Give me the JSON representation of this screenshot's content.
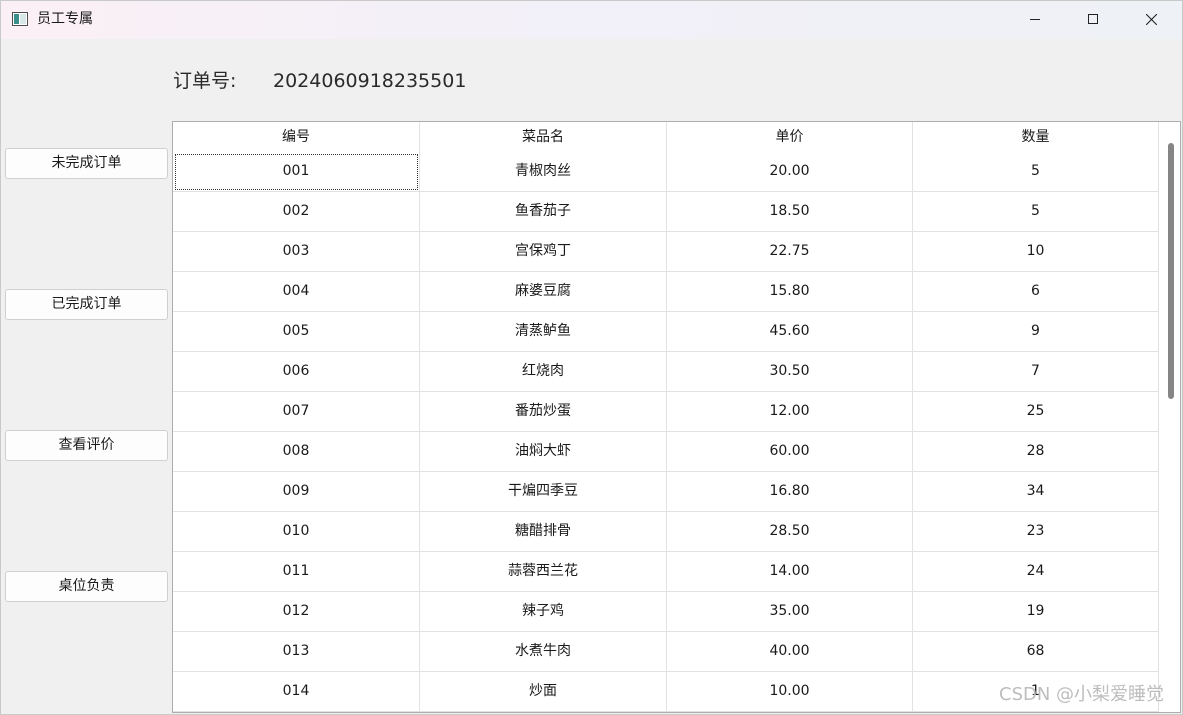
{
  "window": {
    "title": "员工专属",
    "minimize_icon": "minimize-icon",
    "maximize_icon": "maximize-icon",
    "close_icon": "close-icon"
  },
  "order": {
    "label": "订单号:",
    "number": "2024060918235501"
  },
  "sidebar": {
    "buttons": [
      {
        "label": "未完成订单"
      },
      {
        "label": "已完成订单"
      },
      {
        "label": "查看评价"
      },
      {
        "label": "桌位负责"
      }
    ]
  },
  "table": {
    "headers": [
      "编号",
      "菜品名",
      "单价",
      "数量"
    ],
    "rows": [
      [
        "001",
        "青椒肉丝",
        "20.00",
        "5"
      ],
      [
        "002",
        "鱼香茄子",
        "18.50",
        "5"
      ],
      [
        "003",
        "宫保鸡丁",
        "22.75",
        "10"
      ],
      [
        "004",
        "麻婆豆腐",
        "15.80",
        "6"
      ],
      [
        "005",
        "清蒸鲈鱼",
        "45.60",
        "9"
      ],
      [
        "006",
        "红烧肉",
        "30.50",
        "7"
      ],
      [
        "007",
        "番茄炒蛋",
        "12.00",
        "25"
      ],
      [
        "008",
        "油焖大虾",
        "60.00",
        "28"
      ],
      [
        "009",
        "干煸四季豆",
        "16.80",
        "34"
      ],
      [
        "010",
        "糖醋排骨",
        "28.50",
        "23"
      ],
      [
        "011",
        "蒜蓉西兰花",
        "14.00",
        "24"
      ],
      [
        "012",
        "辣子鸡",
        "35.00",
        "19"
      ],
      [
        "013",
        "水煮牛肉",
        "40.00",
        "68"
      ],
      [
        "014",
        "炒面",
        "10.00",
        "1"
      ]
    ]
  },
  "watermark": "CSDN @小梨爱睡觉"
}
